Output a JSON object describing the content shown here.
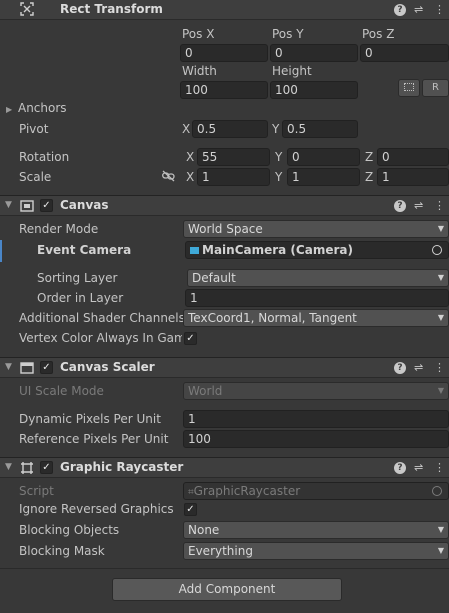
{
  "rect_transform": {
    "title": "Rect Transform",
    "pos_x_label": "Pos X",
    "pos_y_label": "Pos Y",
    "pos_z_label": "Pos Z",
    "pos_x": "0",
    "pos_y": "0",
    "pos_z": "0",
    "width_label": "Width",
    "height_label": "Height",
    "width": "100",
    "height": "100",
    "r_button": "R",
    "anchors_label": "Anchors",
    "pivot_label": "Pivot",
    "pivot_x": "0.5",
    "pivot_y": "0.5",
    "rotation_label": "Rotation",
    "rot_x": "55",
    "rot_y": "0",
    "rot_z": "0",
    "scale_label": "Scale",
    "scale_x": "1",
    "scale_y": "1",
    "scale_z": "1",
    "axis_x": "X",
    "axis_y": "Y",
    "axis_z": "Z"
  },
  "canvas": {
    "title": "Canvas",
    "render_mode_label": "Render Mode",
    "render_mode": "World Space",
    "event_camera_label": "Event Camera",
    "event_camera": "MainCamera (Camera)",
    "sorting_layer_label": "Sorting Layer",
    "sorting_layer": "Default",
    "order_in_layer_label": "Order in Layer",
    "order_in_layer": "1",
    "shader_channels_label": "Additional Shader Channels",
    "shader_channels": "TexCoord1, Normal, Tangent",
    "vertex_color_label": "Vertex Color Always In Gamm",
    "vertex_color_checked": "✓"
  },
  "canvas_scaler": {
    "title": "Canvas Scaler",
    "ui_scale_mode_label": "UI Scale Mode",
    "ui_scale_mode": "World",
    "dynamic_pixels_label": "Dynamic Pixels Per Unit",
    "dynamic_pixels": "1",
    "reference_pixels_label": "Reference Pixels Per Unit",
    "reference_pixels": "100"
  },
  "graphic_raycaster": {
    "title": "Graphic Raycaster",
    "script_label": "Script",
    "script": "GraphicRaycaster",
    "ignore_reversed_label": "Ignore Reversed Graphics",
    "ignore_reversed_checked": "✓",
    "blocking_objects_label": "Blocking Objects",
    "blocking_objects": "None",
    "blocking_mask_label": "Blocking Mask",
    "blocking_mask": "Everything"
  },
  "common": {
    "check": "✓",
    "help": "?",
    "preset": "⇌",
    "menu": "⋮",
    "caret": "▼",
    "collapse": "▼",
    "expand": "▶"
  },
  "add_component": "Add Component"
}
